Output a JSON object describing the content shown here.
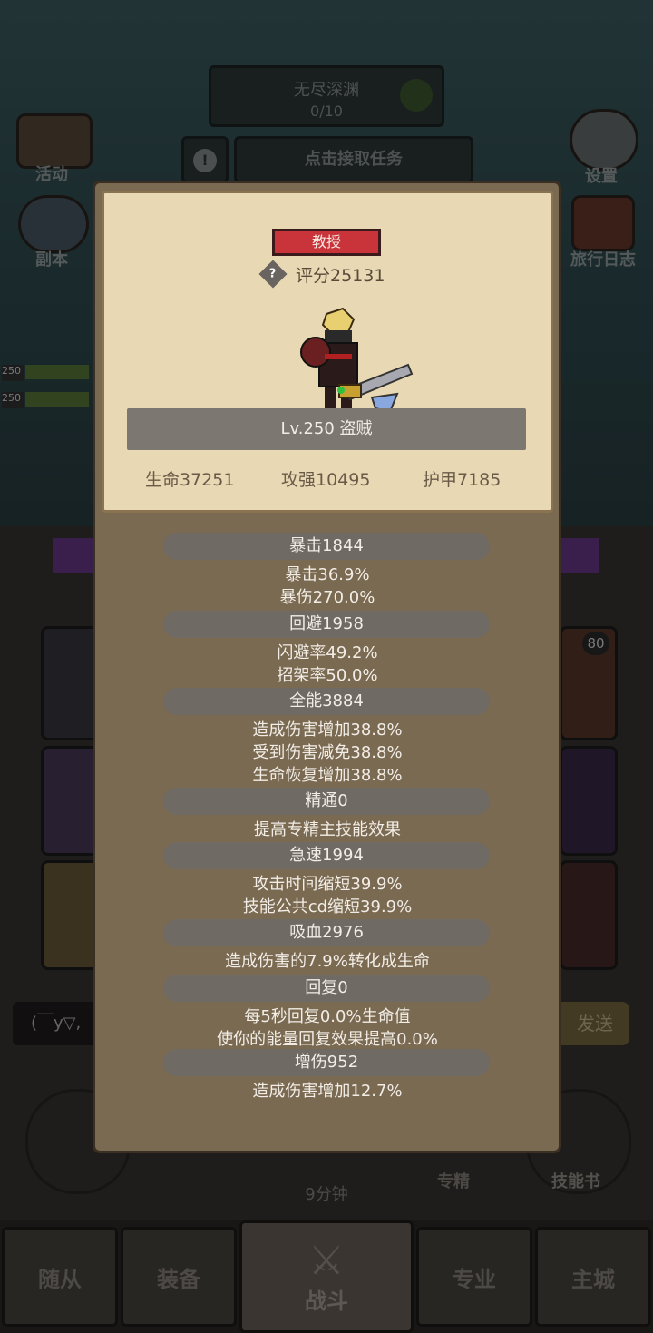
{
  "background": {
    "endless_abyss": {
      "title": "无尽深渊",
      "progress": "0/10"
    },
    "task_button": "点击接取任务",
    "left_icons": [
      {
        "label": "活动",
        "icon": "activity-scroll-icon"
      },
      {
        "label": "副本",
        "icon": "dungeon-portal-icon"
      }
    ],
    "right_icons": [
      {
        "label": "设置",
        "icon": "gear-icon"
      },
      {
        "label": "旅行日志",
        "icon": "travel-log-book-icon"
      }
    ],
    "team_levels": [
      "250",
      "250"
    ],
    "badge_number": "80",
    "chat_text": "(￣y▽,",
    "chat_send": "发送",
    "timer": "9分钟",
    "skill_labels": [
      "专精",
      "技能书"
    ],
    "bottom_tabs": [
      "随从",
      "装备",
      "战斗",
      "专业",
      "主城"
    ]
  },
  "panel": {
    "title_badge": "教授",
    "score": "评分25131",
    "help_icon": "question-diamond-icon",
    "level_text": "Lv.250 盗贼",
    "basic_stats": {
      "hp": "生命37251",
      "attack": "攻强10495",
      "armor": "护甲7185"
    },
    "stats": [
      {
        "header": "暴击1844",
        "lines": [
          "暴击36.9%",
          "暴伤270.0%"
        ]
      },
      {
        "header": "回避1958",
        "lines": [
          "闪避率49.2%",
          "招架率50.0%"
        ]
      },
      {
        "header": "全能3884",
        "lines": [
          "造成伤害增加38.8%",
          "受到伤害减免38.8%",
          "生命恢复增加38.8%"
        ]
      },
      {
        "header": "精通0",
        "lines": [
          "提高专精主技能效果"
        ]
      },
      {
        "header": "急速1994",
        "lines": [
          "攻击时间缩短39.9%",
          "技能公共cd缩短39.9%"
        ]
      },
      {
        "header": "吸血2976",
        "lines": [
          "造成伤害的7.9%转化成生命"
        ]
      },
      {
        "header": "回复0",
        "lines": [
          "每5秒回复0.0%生命值",
          "使你的能量回复效果提高0.0%"
        ]
      },
      {
        "header": "增伤952",
        "lines": [
          "造成伤害增加12.7%"
        ]
      }
    ]
  }
}
